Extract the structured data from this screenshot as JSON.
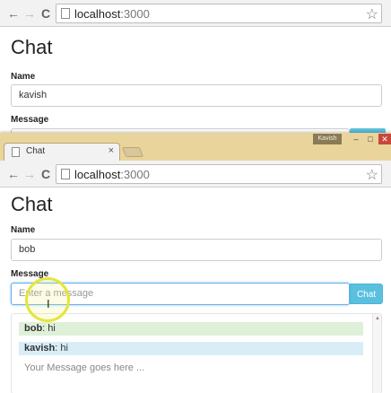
{
  "window_back": {
    "url_host": "localhost",
    "url_port": ":3000",
    "page_title": "Chat",
    "name_label": "Name",
    "name_value": "kavish",
    "message_label": "Message"
  },
  "window_front": {
    "tab_title": "Chat",
    "tab_close": "×",
    "profile_name": "Kavish",
    "url_host": "localhost",
    "url_port": ":3000",
    "page_title": "Chat",
    "name_label": "Name",
    "name_value": "bob",
    "message_label": "Message",
    "message_placeholder": "Enter a message",
    "chat_button": "Chat",
    "messages": [
      {
        "user": "bob",
        "text": ": hi",
        "style": "green"
      },
      {
        "user": "kavish",
        "text": ": hi",
        "style": "blue"
      }
    ],
    "message_hint": "Your Message goes here ..."
  },
  "icons": {
    "back": "←",
    "forward": "→",
    "reload": "C",
    "star": "☆",
    "minimize": "–",
    "maximize": "□",
    "close": "✕"
  },
  "colors": {
    "accent": "#5bc0de",
    "titlebar": "#e9d49c",
    "msg_green": "#dff0d8",
    "msg_blue": "#d9edf7"
  }
}
